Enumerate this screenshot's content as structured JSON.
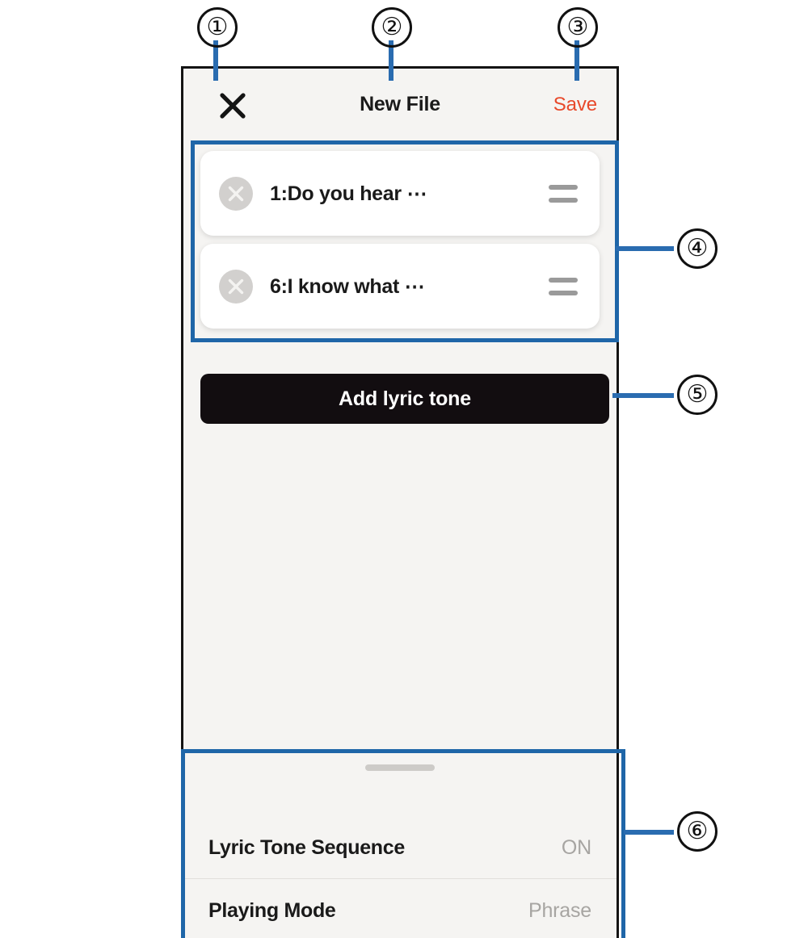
{
  "app": {
    "title": "New File",
    "close_icon": "close-x-icon",
    "save_label": "Save"
  },
  "tone_list": {
    "items": [
      {
        "label": "1:Do you hear ⋯",
        "delete_icon": "circle-x-icon",
        "drag_icon": "drag-handle-icon"
      },
      {
        "label": "6:I know what ⋯",
        "delete_icon": "circle-x-icon",
        "drag_icon": "drag-handle-icon"
      }
    ]
  },
  "add_button": {
    "label": "Add lyric tone"
  },
  "bottom_sheet": {
    "grabber_icon": "sheet-grabber-icon",
    "rows": [
      {
        "label": "Lyric Tone Sequence",
        "value": "ON"
      },
      {
        "label": "Playing Mode",
        "value": "Phrase"
      }
    ]
  },
  "callouts": [
    {
      "number": "①"
    },
    {
      "number": "②"
    },
    {
      "number": "③"
    },
    {
      "number": "④"
    },
    {
      "number": "⑤"
    },
    {
      "number": "⑥"
    }
  ],
  "colors": {
    "accent_save": "#e8492b",
    "annotation_blue": "#1f66a8",
    "button_black": "#120d10",
    "screen_bg": "#f5f4f2"
  }
}
